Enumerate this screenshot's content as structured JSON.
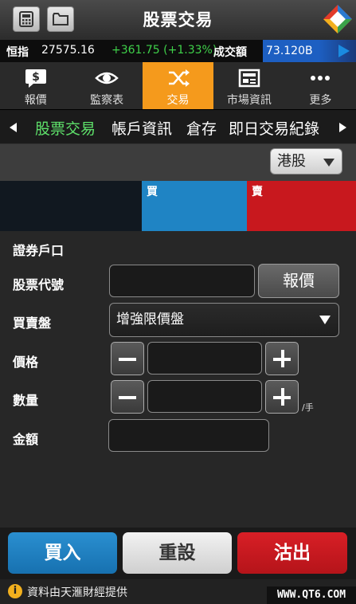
{
  "app": {
    "title": "股票交易"
  },
  "ticker": {
    "index_label": "恒指",
    "index_value": "27575.16",
    "index_change": "+361.75 (+1.33%)",
    "turnover_label": "成交額",
    "turnover_value": "73.120B"
  },
  "nav": {
    "items": [
      {
        "label": "報價",
        "icon": "quote-icon"
      },
      {
        "label": "監察表",
        "icon": "eye-icon"
      },
      {
        "label": "交易",
        "icon": "shuffle-icon",
        "active": true
      },
      {
        "label": "市場資訊",
        "icon": "news-icon"
      },
      {
        "label": "更多",
        "icon": "more-icon"
      }
    ]
  },
  "subtabs": [
    "股票交易",
    "帳戶資訊",
    "倉存",
    "即日交易紀錄"
  ],
  "market": {
    "selected": "港股"
  },
  "bidask": {
    "buy_label": "買",
    "sell_label": "賣"
  },
  "form": {
    "account_label": "證券戶口",
    "code_label": "股票代號",
    "code_value": "",
    "quote_button": "報價",
    "order_type_label": "買賣盤",
    "order_type_value": "增強限價盤",
    "price_label": "價格",
    "price_value": "",
    "qty_label": "數量",
    "qty_value": "",
    "qty_unit": "/手",
    "amount_label": "金額",
    "amount_value": ""
  },
  "actions": {
    "buy": "買入",
    "reset": "重設",
    "sell": "沽出"
  },
  "footer": {
    "info": "資料由天滙財經提供",
    "watermark": "WWW.QT6.COM"
  },
  "colors": {
    "accent": "#f59a1c",
    "buy": "#1f84c4",
    "sell": "#c8181e",
    "positive": "#3fd14a"
  }
}
